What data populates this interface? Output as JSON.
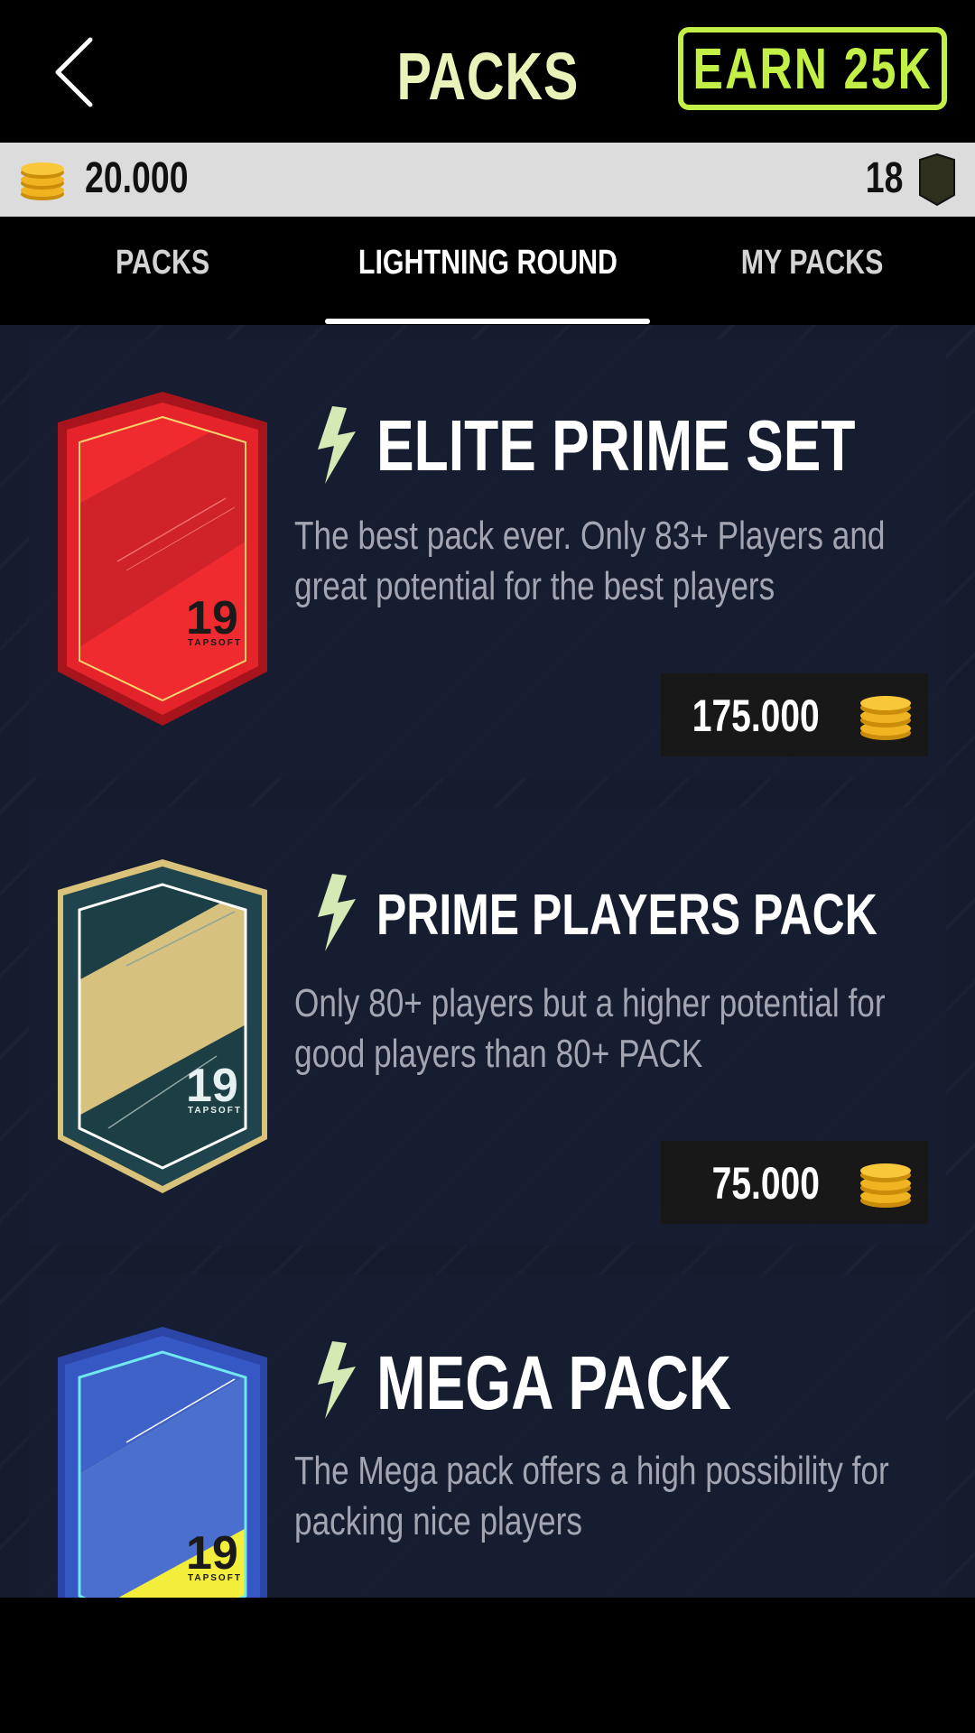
{
  "header": {
    "title": "PACKS",
    "earn_label": "EARN 25K"
  },
  "balance": {
    "coins": "20.000",
    "packs": "18"
  },
  "tabs": [
    {
      "label": "PACKS",
      "active": false
    },
    {
      "label": "LIGHTNING ROUND",
      "active": true
    },
    {
      "label": "MY PACKS",
      "active": false
    }
  ],
  "packs": [
    {
      "title": "ELITE PRIME SET",
      "description_lines": [
        "The best pack ever. Only 83+ Players and",
        "great potential for the best players"
      ],
      "price": "175.000",
      "badge_label": "19",
      "badge_brand": "TAPSOFT"
    },
    {
      "title": "PRIME PLAYERS PACK",
      "description_lines": [
        "Only 80+ players but a higher potential for",
        "good players than 80+ PACK"
      ],
      "price": "75.000",
      "badge_label": "19",
      "badge_brand": "TAPSOFT"
    },
    {
      "title": "MEGA PACK",
      "description_lines": [
        "The Mega pack offers a high possibility for",
        "packing nice players"
      ],
      "badge_label": "19",
      "badge_brand": "TAPSOFT"
    }
  ],
  "colors": {
    "title": "#e9f3b9",
    "accent_green": "#c3f046",
    "content_bg": "#161b2e",
    "elite_red": "#e8242a",
    "prime_teal": "#1e4a54",
    "prime_gold": "#d9c27a",
    "mega_blue": "#2f4fb8",
    "mega_yellow": "#f5ef3a"
  },
  "icons": [
    "back-chevron-icon",
    "coin-stack-icon",
    "pack-badge-icon",
    "lightning-bolt-icon"
  ]
}
